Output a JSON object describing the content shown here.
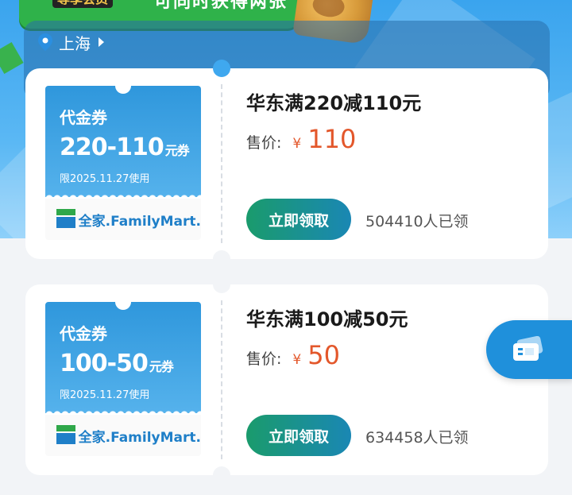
{
  "banner": {
    "member_text": "尊享会员",
    "both_text": "可同时获得两张"
  },
  "location": {
    "city": "上海"
  },
  "coupons": [
    {
      "voucher_kind": "代金券",
      "voucher_amount": "220-110",
      "voucher_unit": "元券",
      "voucher_limit": "限2025.11.27使用",
      "brand": "全家.FamilyMart.",
      "title": "华东满220减110元",
      "price_label": "售价:",
      "currency": "¥",
      "price": "110",
      "claim_label": "立即领取",
      "claimed_count": "504410人已领"
    },
    {
      "voucher_kind": "代金券",
      "voucher_amount": "100-50",
      "voucher_unit": "元券",
      "voucher_limit": "限2025.11.27使用",
      "brand": "全家.FamilyMart.",
      "title": "华东满100减50元",
      "price_label": "售价:",
      "currency": "¥",
      "price": "50",
      "claim_label": "立即领取",
      "claimed_count": "634458人已领"
    }
  ],
  "float_button": {
    "icon": "ticket-icon"
  },
  "colors": {
    "accent_price": "#e3572b",
    "button_gradient_start": "#1a9b6c",
    "button_gradient_end": "#1a87b4",
    "hero_blue": "#3aa4ee"
  }
}
